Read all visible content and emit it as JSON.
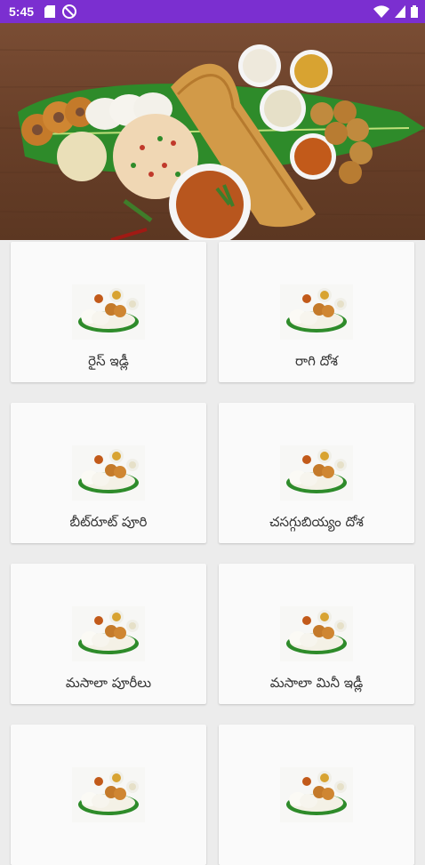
{
  "status_bar": {
    "time": "5:45",
    "left_icons": [
      "sd-card-icon",
      "do-not-disturb-icon"
    ],
    "right_icons": [
      "wifi-icon",
      "cellular-signal-icon",
      "battery-icon"
    ],
    "color": "#7b2fd0"
  },
  "hero": {
    "image": "south-indian-breakfast-platter-banner"
  },
  "recipes": [
    {
      "label": "రైస్ ఇడ్లీ"
    },
    {
      "label": "రాగి దోశ"
    },
    {
      "label": "బీట్‌రూట్ పూరి"
    },
    {
      "label": "చసగ్గుబియ్యం దోశ"
    },
    {
      "label": "మసాలా పూరీలు"
    },
    {
      "label": "మసాలా మినీ ఇడ్లీ"
    },
    {
      "label": ""
    },
    {
      "label": ""
    }
  ]
}
